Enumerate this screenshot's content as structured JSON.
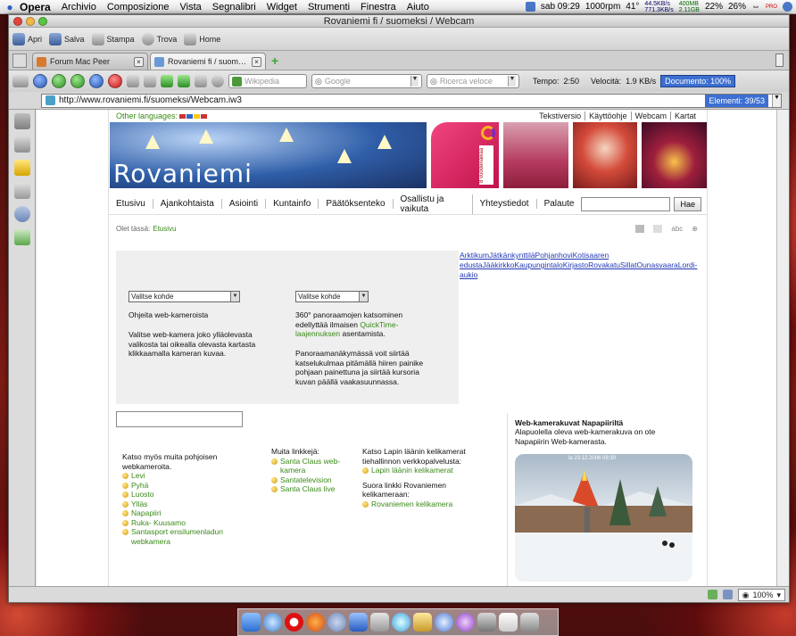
{
  "menubar": {
    "app_name": "Opera",
    "menus": [
      "Archivio",
      "Composizione",
      "Vista",
      "Segnalibri",
      "Widget",
      "Strumenti",
      "Finestra",
      "Aiuto"
    ],
    "clock": "sab 09:29",
    "rpm": "1000rpm",
    "temp": "41°",
    "net_up": "44.5KB/s",
    "net_down": "771.3KB/s",
    "mem_used": "400MB",
    "mem_free": "2.11GB",
    "cpu1": "22%",
    "cpu2": "26%",
    "flag_label": "PRO"
  },
  "window": {
    "title": "Rovaniemi fi / suomeksi / Webcam"
  },
  "toolbar": {
    "apri": "Apri",
    "salva": "Salva",
    "stampa": "Stampa",
    "trova": "Trova",
    "home": "Home"
  },
  "tabs": [
    {
      "label": "Forum Mac Peer",
      "close": "×"
    },
    {
      "label": "Rovaniemi fi / suomeksi...",
      "close": "×"
    }
  ],
  "navbar": {
    "search1_placeholder": "Wikipedia",
    "search2_placeholder": "Google",
    "search3_placeholder": "Ricerca veloce",
    "tempo_label": "Tempo:",
    "tempo_value": "2:50",
    "velocita_label": "Velocità:",
    "velocita_value": "1.9 KB/s",
    "document_badge": "Documento: 100%"
  },
  "address": {
    "url": "http://www.rovaniemi.fi/suomeksi/Webcam.iw3",
    "elements": "Elementi: 39/53"
  },
  "statusbar": {
    "zoom": "100%"
  },
  "page": {
    "other_languages": "Other languages:",
    "top_links": [
      "Tekstiversio",
      "Käyttöohje",
      "Webcam",
      "Kartat"
    ],
    "logo": "Rovaniemi",
    "banner_vertical": "8 vuodenaikaa",
    "nav": [
      "Etusivu",
      "Ajankohtaista",
      "Asiointi",
      "Kuntainfo",
      "Päätöksenteko",
      "Osallistu ja vaikuta",
      "Yhteystiedot",
      "Palaute"
    ],
    "search_button": "Hae",
    "crumb_label": "Olet tässä:",
    "crumb_link": "Etusivu",
    "abc": "abc",
    "select1": "Valitse kohde",
    "select2": "Valitse kohde",
    "left_heading": "Ohjeita web-kameroista",
    "left_text": "Valitse web-kamera joko ylläolevasta valikosta tai oikealla olevasta kartasta klikkaamalla kameran kuvaa.",
    "mid_text1": "360° panoraamojen katsominen edellyttää ilmaisen",
    "mid_link": "QuickTime-laajennuksen",
    "mid_text2": "asentamista.",
    "mid_text3": "Panoraamanäkymässä voit siirtää katselukulmaa pitämällä hiiren painike pohjaan painettuna ja siirtää kursoria kuvan päällä vaakasuunnassa.",
    "right_links_text": "ArktikumJätkänkynttiläPohjanhoviKotisaaren edustaJääkirkkoKaupungintaloKirjastoRovakatuSillatOunasvaaraLordi-aukio",
    "col1_heading": "Katso myös muita pohjoisen webkameroita.",
    "col1_items": [
      "Levi",
      "Pyhä",
      "Luosto",
      "Ylläs",
      "Napapiiri",
      "Ruka- Kuusamo",
      "Santasport ensilumenladun webkamera"
    ],
    "col2_heading": "Muita linkkejä:",
    "col2_items": [
      "Santa Claus web-kamera",
      "Santatelevision",
      "Santa Claus live"
    ],
    "col3_heading": "Katso Lapin läänin kelikamerat tiehallinnon verkkopalvelusta:",
    "col3_item1": "Lapin läänin kelikamerat",
    "col3_heading2": "Suora linkki Rovaniemen kelikameraan:",
    "col3_item2": "Rovaniemen kelikamera",
    "webcam_title": "Web-kamerakuvat Napapiiriltä",
    "webcam_desc": "Alapuolella oleva web-kamerakuva on ote Napapiirin Web-kamerasta.",
    "webcam_timestamp": "la 23.12.2006 09:30"
  },
  "colors": {
    "link_green": "#3a8a19",
    "link_blue": "#2238b5",
    "accent_pink": "#e0306b"
  }
}
